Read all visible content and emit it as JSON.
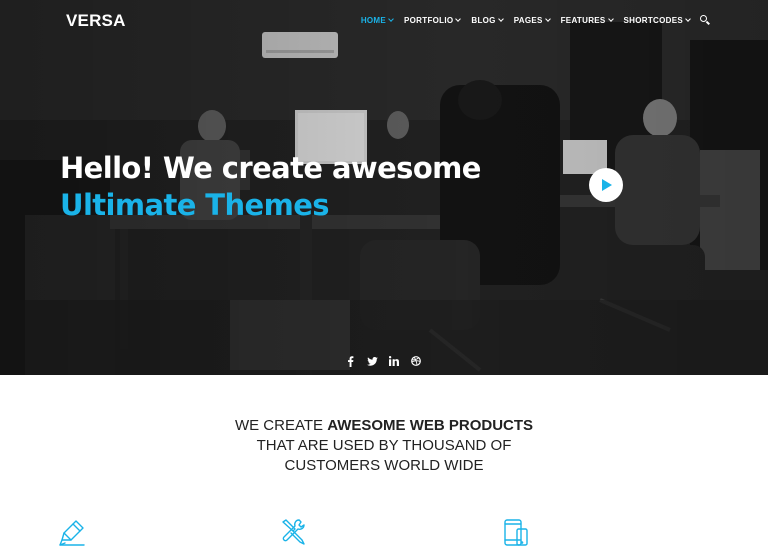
{
  "brand": {
    "logo": "VERSA"
  },
  "nav": {
    "items": [
      {
        "label": "HOME",
        "active": true
      },
      {
        "label": "PORTFOLIO",
        "active": false
      },
      {
        "label": "BLOG",
        "active": false
      },
      {
        "label": "PAGES",
        "active": false
      },
      {
        "label": "FEATURES",
        "active": false
      },
      {
        "label": "SHORTCODES",
        "active": false
      }
    ],
    "search_icon": "search-icon"
  },
  "hero": {
    "line1": "Hello! We create awesome",
    "line2": "Ultimate Themes",
    "play_icon": "play-icon",
    "social": [
      {
        "icon": "facebook-icon",
        "glyph": "f"
      },
      {
        "icon": "twitter-icon",
        "glyph": "t"
      },
      {
        "icon": "linkedin-icon",
        "glyph": "in"
      },
      {
        "icon": "dribbble-icon",
        "glyph": "⊛"
      }
    ]
  },
  "intro": {
    "line1_prefix": "WE CREATE ",
    "line1_bold": "AWESOME WEB PRODUCTS",
    "line2": "THAT ARE USED BY THOUSAND OF",
    "line3": "CUSTOMERS WORLD WIDE"
  },
  "features": [
    {
      "icon": "pencil-icon"
    },
    {
      "icon": "tools-icon"
    },
    {
      "icon": "devices-icon"
    }
  ],
  "colors": {
    "accent": "#1ab3e8",
    "text": "#222222",
    "white": "#ffffff"
  }
}
